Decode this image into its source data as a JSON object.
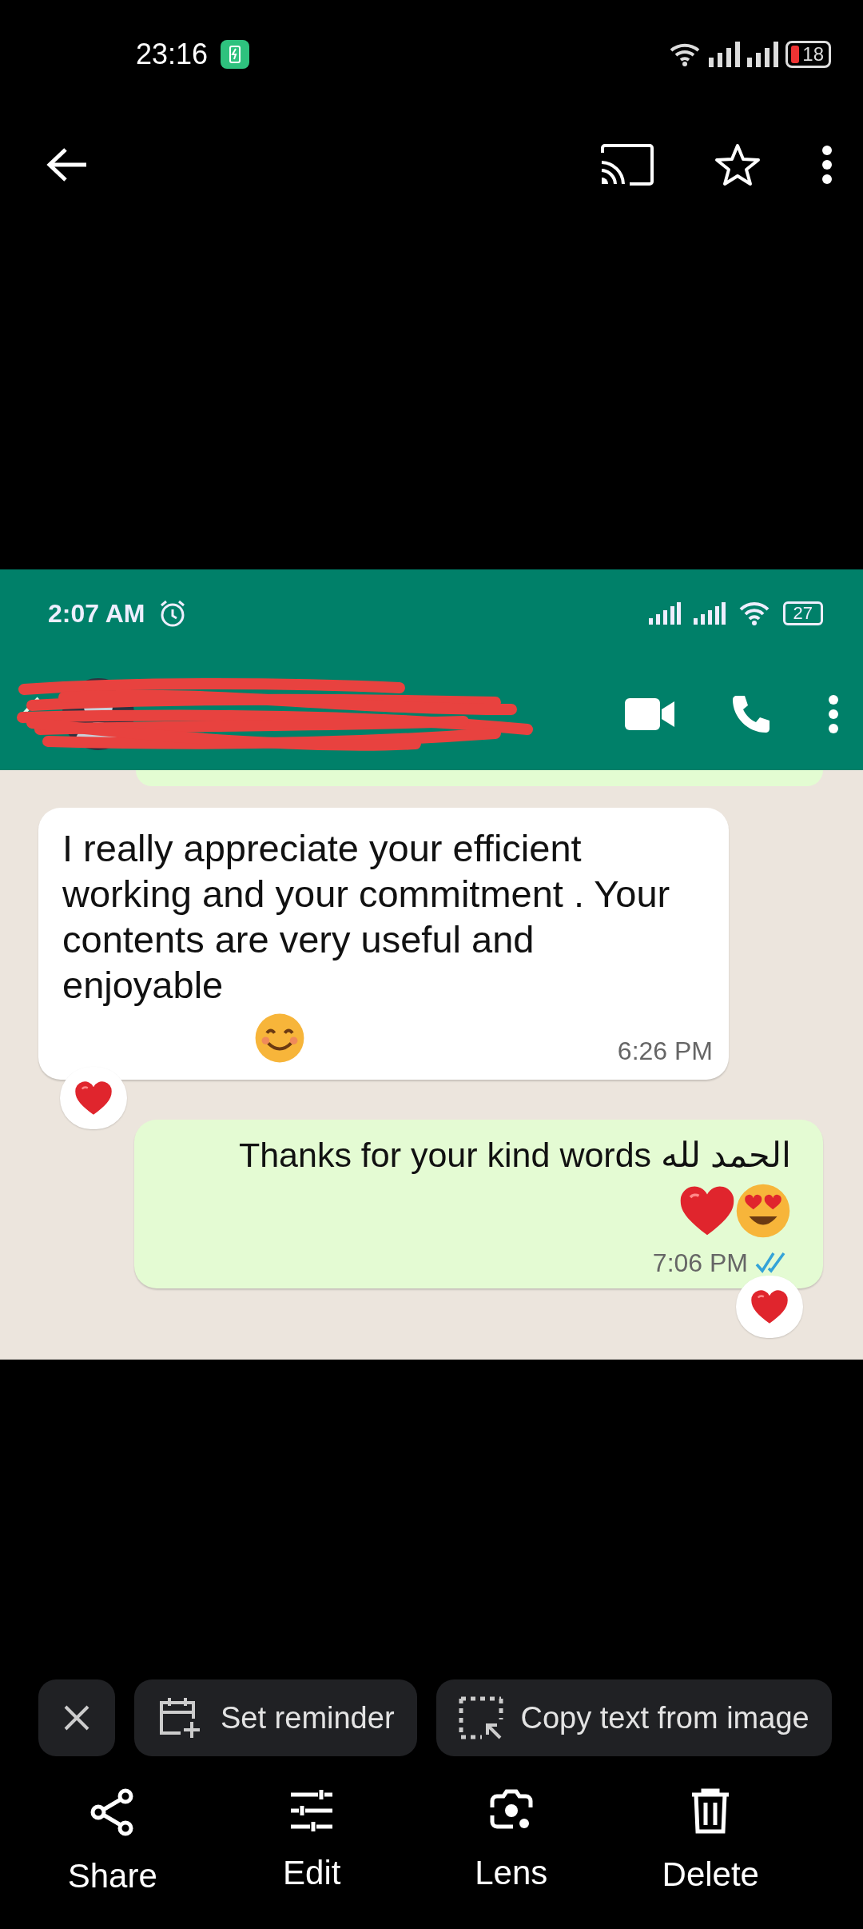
{
  "status_bar": {
    "time": "23:16",
    "battery": "18"
  },
  "screenshot": {
    "status_bar": {
      "time": "2:07 AM",
      "battery": "27"
    },
    "messages": [
      {
        "outgoing": false,
        "text": "I really appreciate your efficient working and your commitment . Your contents are very useful and enjoyable",
        "time": "6:26 PM"
      },
      {
        "outgoing": true,
        "text": "Thanks for your kind words الحمد لله",
        "time": "7:06 PM",
        "read": true
      }
    ]
  },
  "chips": [
    "Set reminder",
    "Copy text from image"
  ],
  "actions": [
    "Share",
    "Edit",
    "Lens",
    "Delete"
  ]
}
